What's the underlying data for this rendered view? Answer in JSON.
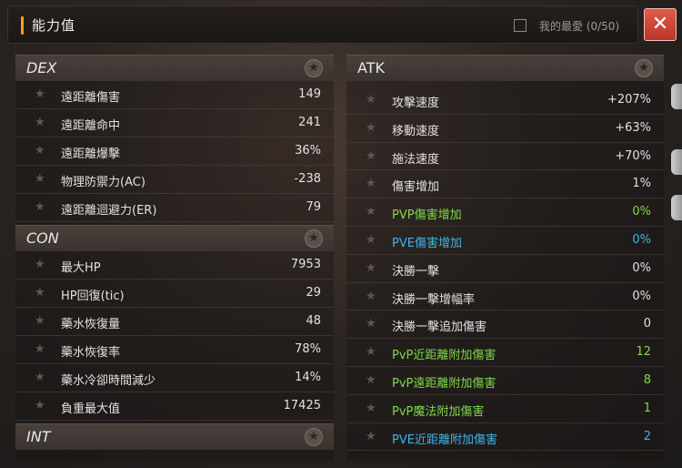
{
  "window": {
    "title": "能力值",
    "favorite_label": "我的最愛 (0/50)",
    "close_label": "✕"
  },
  "colors": {
    "accent": "#f0a020",
    "close": "#d04838",
    "pvp_green": "#7fd94a",
    "pve_blue": "#3fb6e8"
  },
  "left_sections": [
    {
      "title": "DEX",
      "rows": [
        {
          "label": "遠距離傷害",
          "value": "149"
        },
        {
          "label": "遠距離命中",
          "value": "241"
        },
        {
          "label": "遠距離爆擊",
          "value": "36%"
        },
        {
          "label": "物理防禦力(AC)",
          "value": "-238"
        },
        {
          "label": "遠距離迴避力(ER)",
          "value": "79"
        }
      ]
    },
    {
      "title": "CON",
      "rows": [
        {
          "label": "最大HP",
          "value": "7953"
        },
        {
          "label": "HP回復(tic)",
          "value": "29"
        },
        {
          "label": "藥水恢復量",
          "value": "48"
        },
        {
          "label": "藥水恢復率",
          "value": "78%"
        },
        {
          "label": "藥水冷卻時間減少",
          "value": "14%"
        },
        {
          "label": "負重最大值",
          "value": "17425"
        }
      ]
    },
    {
      "title": "INT",
      "rows": []
    }
  ],
  "right_sections": [
    {
      "title": "ATK",
      "rows": [
        {
          "label": "攻擊速度",
          "value": "+207%",
          "tone": "normal"
        },
        {
          "label": "移動速度",
          "value": "+63%",
          "tone": "normal"
        },
        {
          "label": "施法速度",
          "value": "+70%",
          "tone": "normal"
        },
        {
          "label": "傷害增加",
          "value": "1%",
          "tone": "normal"
        },
        {
          "label": "PVP傷害增加",
          "value": "0%",
          "tone": "green"
        },
        {
          "label": "PVE傷害增加",
          "value": "0%",
          "tone": "blue"
        },
        {
          "label": "決勝一擊",
          "value": "0%",
          "tone": "normal"
        },
        {
          "label": "決勝一擊增幅率",
          "value": "0%",
          "tone": "normal"
        },
        {
          "label": "決勝一擊追加傷害",
          "value": "0",
          "tone": "normal"
        },
        {
          "label": "PvP近距離附加傷害",
          "value": "12",
          "tone": "green"
        },
        {
          "label": "PvP遠距離附加傷害",
          "value": "8",
          "tone": "green"
        },
        {
          "label": "PvP魔法附加傷害",
          "value": "1",
          "tone": "green"
        },
        {
          "label": "PVE近距離附加傷害",
          "value": "2",
          "tone": "blue"
        }
      ]
    }
  ],
  "icons": {
    "row_star": "★",
    "section_star": "★"
  }
}
